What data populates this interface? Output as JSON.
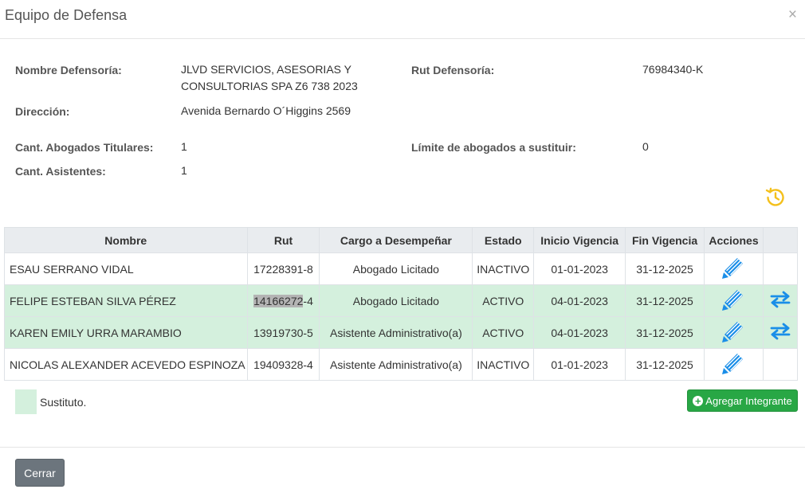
{
  "modal": {
    "title": "Equipo de Defensa",
    "close_symbol": "×"
  },
  "info": {
    "nombre_label": "Nombre Defensoría:",
    "nombre_line1": "JLVD SERVICIOS, ASESORIAS Y",
    "nombre_line2": "CONSULTORIAS SPA Z6 738 2023",
    "rut_label": "Rut Defensoría:",
    "rut_value": "76984340-K",
    "direccion_label": "Dirección:",
    "direccion_value": "Avenida Bernardo O´Higgins 2569",
    "titulares_label": "Cant. Abogados Titulares:",
    "titulares_value": "1",
    "limite_label": "Límite de abogados a sustituir:",
    "limite_value": "0",
    "asistentes_label": "Cant. Asistentes:",
    "asistentes_value": "1"
  },
  "table": {
    "headers": [
      "Nombre",
      "Rut",
      "Cargo a Desempeñar",
      "Estado",
      "Inicio Vigencia",
      "Fin Vigencia",
      "Acciones",
      ""
    ],
    "rows": [
      {
        "nombre": "ESAU SERRANO VIDAL",
        "rut": "17228391-8",
        "cargo": "Abogado Licitado",
        "estado": "INACTIVO",
        "inicio": "01-01-2023",
        "fin": "31-12-2025"
      },
      {
        "nombre": "FELIPE ESTEBAN SILVA PÉREZ",
        "rut_hl": "14166272",
        "rut_rest": "-4",
        "cargo": "Abogado Licitado",
        "estado": "ACTIVO",
        "inicio": "04-01-2023",
        "fin": "31-12-2025"
      },
      {
        "nombre": "KAREN EMILY URRA MARAMBIO",
        "rut": "13919730-5",
        "cargo": "Asistente Administrativo(a)",
        "estado": "ACTIVO",
        "inicio": "04-01-2023",
        "fin": "31-12-2025"
      },
      {
        "nombre": "NICOLAS ALEXANDER ACEVEDO ESPINOZA",
        "rut": "19409328-4",
        "cargo": "Asistente Administrativo(a)",
        "estado": "INACTIVO",
        "inicio": "01-01-2023",
        "fin": "31-12-2025"
      }
    ]
  },
  "legend": {
    "text": "Sustituto."
  },
  "buttons": {
    "add": "Agregar Integrante",
    "close": "Cerrar"
  },
  "colors": {
    "substitute_row": "#d4f0dd",
    "edit_icon": "#1a8ee8",
    "swap_icon": "#1a8ee8",
    "history_icon": "#f4c01c",
    "add_button": "#28a745",
    "close_button": "#6c757d"
  }
}
